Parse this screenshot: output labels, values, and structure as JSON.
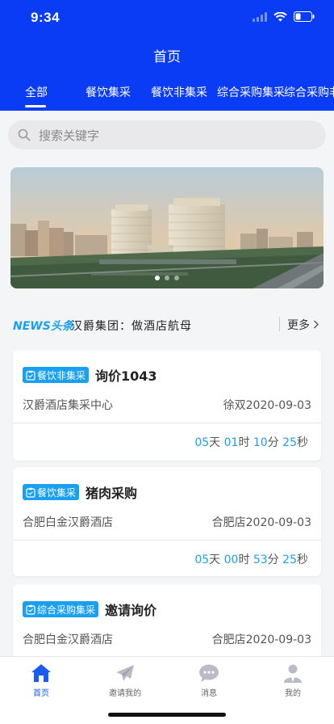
{
  "status_bar": {
    "time": "9:34"
  },
  "header": {
    "title": "首页"
  },
  "tabs": [
    {
      "label": "全部"
    },
    {
      "label": "餐饮集采"
    },
    {
      "label": "餐饮非集采"
    },
    {
      "label": "综合采购集采"
    },
    {
      "label": "综合采购非"
    }
  ],
  "search": {
    "placeholder": "搜索关键字"
  },
  "banner": {
    "slides": 3,
    "active": 1
  },
  "news": {
    "logo_a": "NEWS",
    "logo_b": "头条",
    "headline": "汉爵集团：做酒店航母",
    "more": "更多"
  },
  "cards": [
    {
      "tag": "餐饮非集采",
      "title": "询价1043",
      "org": "汉爵酒店集采中心",
      "meta": "徐双2020-09-03",
      "countdown": {
        "days": "05",
        "hours": "01",
        "minutes": "10",
        "seconds": "25"
      }
    },
    {
      "tag": "餐饮集采",
      "title": "猪肉采购",
      "org": "合肥白金汉爵酒店",
      "meta": "合肥店2020-09-03",
      "countdown": {
        "days": "05",
        "hours": "00",
        "minutes": "53",
        "seconds": "25"
      }
    },
    {
      "tag": "综合采购集采",
      "title": "邀请询价",
      "org": "合肥白金汉爵酒店",
      "meta": "合肥店2020-09-03"
    }
  ],
  "countdown_units": {
    "day": "天",
    "hour": "时",
    "minute": "分",
    "second": "秒"
  },
  "tabbar": [
    {
      "label": "首页",
      "icon": "home-icon"
    },
    {
      "label": "邀请我的",
      "icon": "paper-plane-icon"
    },
    {
      "label": "消息",
      "icon": "chat-bubble-icon"
    },
    {
      "label": "我的",
      "icon": "user-icon"
    }
  ],
  "colors": {
    "brand": "#0a3cf5",
    "accent": "#1aa0f0",
    "active_tab": "#1a5cf0"
  }
}
